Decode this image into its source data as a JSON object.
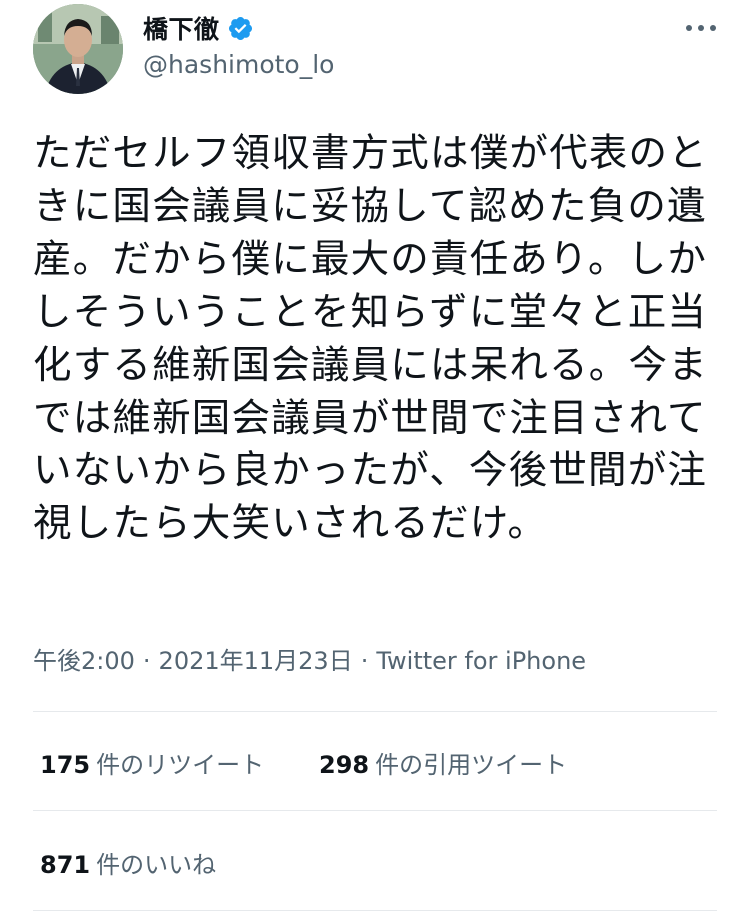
{
  "author": {
    "display_name": "橋下徹",
    "handle": "@hashimoto_lo",
    "verified": true
  },
  "tweet": {
    "text": "ただセルフ領収書方式は僕が代表のときに国会議員に妥協して認めた負の遺産。だから僕に最大の責任あり。しかしそういうことを知らずに堂々と正当化する維新国会議員には呆れる。今までは維新国会議員が世間で注目されていないから良かったが、今後世間が注視したら大笑いされるだけ。",
    "time": "午後2:00",
    "date": "2021年11月23日",
    "source": "Twitter for iPhone",
    "separator": "·"
  },
  "stats": {
    "retweets": {
      "count": "175",
      "label": "件のリツイート"
    },
    "quotes": {
      "count": "298",
      "label": "件の引用ツイート"
    },
    "likes": {
      "count": "871",
      "label": "件のいいね"
    }
  },
  "icons": {
    "verified": "verified-badge-icon",
    "more": "more-dots-icon"
  },
  "colors": {
    "text": "#0f1419",
    "secondary": "#536471",
    "verified": "#1d9bf0",
    "divider": "#e6e9ec"
  }
}
